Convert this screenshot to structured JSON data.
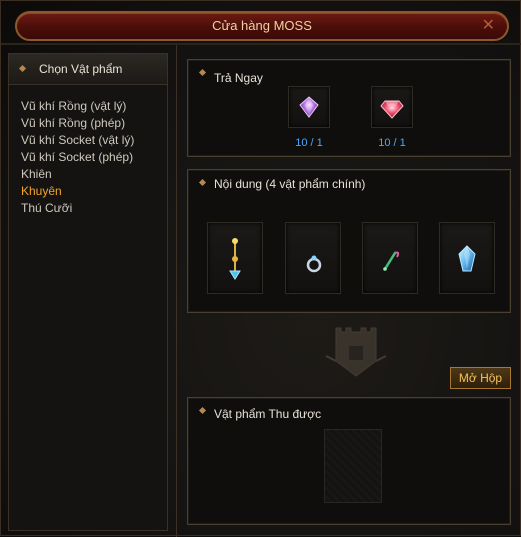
{
  "window": {
    "title": "Cửa hàng MOSS",
    "close_icon": "close-icon"
  },
  "sidebar": {
    "header": "Chọn Vật phẩm",
    "items": [
      {
        "label": "Vũ khí Rồng (vật lý)",
        "active": false
      },
      {
        "label": "Vũ khí Rồng (phép)",
        "active": false
      },
      {
        "label": "Vũ khí Socket (vật lý)",
        "active": false
      },
      {
        "label": "Vũ khí Socket (phép)",
        "active": false
      },
      {
        "label": "Khiên",
        "active": false
      },
      {
        "label": "Khuyên",
        "active": true
      },
      {
        "label": "Thú Cưỡi",
        "active": false
      }
    ],
    "active_color": "#f0a526"
  },
  "pay_now": {
    "title": "Trả Ngay",
    "items": [
      {
        "icon": "purple-gem-icon",
        "qty": "10 / 1"
      },
      {
        "icon": "red-gem-icon",
        "qty": "10 / 1"
      }
    ],
    "qty_color": "#4aa8ff"
  },
  "contents": {
    "title": "Nội dung (4 vật phẩm chính)",
    "items": [
      {
        "icon": "golden-wand-icon"
      },
      {
        "icon": "ring-icon"
      },
      {
        "icon": "green-staff-icon"
      },
      {
        "icon": "blue-crystal-icon"
      }
    ]
  },
  "open_box": {
    "label": "Mở Hộp"
  },
  "result": {
    "title": "Vật phẩm Thu được"
  }
}
